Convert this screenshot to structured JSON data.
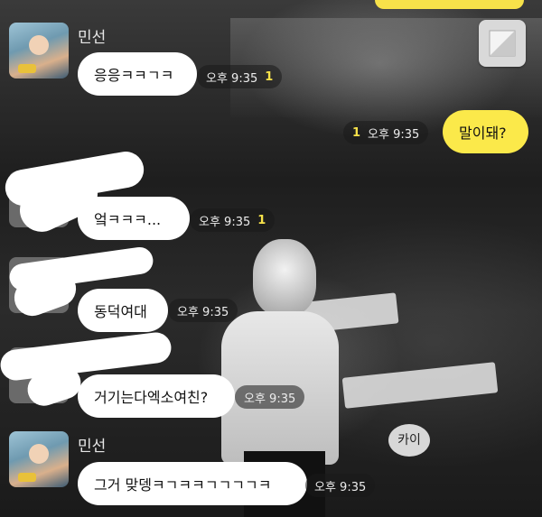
{
  "colors": {
    "mine_bubble": "#fbe94a",
    "their_bubble": "#ffffff",
    "unread_marker": "#f7e24a"
  },
  "icons": {
    "corner_button": "image-icon"
  },
  "messages": [
    {
      "sender": "민선",
      "text": "응응ㅋㅋㄱㅋ",
      "time": "오후 9:35",
      "unread": "1"
    },
    {
      "sender": "me",
      "text": "말이돼?",
      "time": "오후 9:35",
      "unread": "1"
    },
    {
      "sender": "hidden",
      "text": "엌ㅋㅋㅋ...",
      "time": "오후 9:35",
      "unread": "1"
    },
    {
      "sender": "hidden",
      "text": "동덕여대",
      "time": "오후 9:35",
      "unread": ""
    },
    {
      "sender": "hidden",
      "text": "거기는다엑소여친?",
      "time": "오후 9:35",
      "unread": ""
    },
    {
      "sender": "민선",
      "text": "그거 맞뎅ㅋㄱㅋㅋㄱㄱㄱㄱㅋ",
      "time": "오후 9:35",
      "unread": ""
    }
  ],
  "background_sign_text": "카이"
}
